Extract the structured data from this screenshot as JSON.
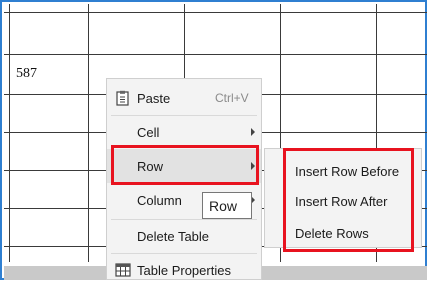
{
  "table": {
    "cell_value": "587"
  },
  "context_menu": {
    "items": [
      {
        "label": "Paste",
        "shortcut": "Ctrl+V",
        "icon": "clipboard-icon"
      },
      {
        "label": "Cell"
      },
      {
        "label": "Row"
      },
      {
        "label": "Column"
      },
      {
        "label": "Delete Table"
      },
      {
        "label": "Table Properties",
        "icon": "table-icon"
      }
    ]
  },
  "tooltip": {
    "text": "Row"
  },
  "row_submenu": {
    "items": [
      {
        "label": "Insert Row Before"
      },
      {
        "label": "Insert Row After"
      },
      {
        "label": "Delete Rows"
      }
    ]
  },
  "colors": {
    "highlight_border": "#e8131f",
    "frame_border": "#2f7fd1"
  }
}
